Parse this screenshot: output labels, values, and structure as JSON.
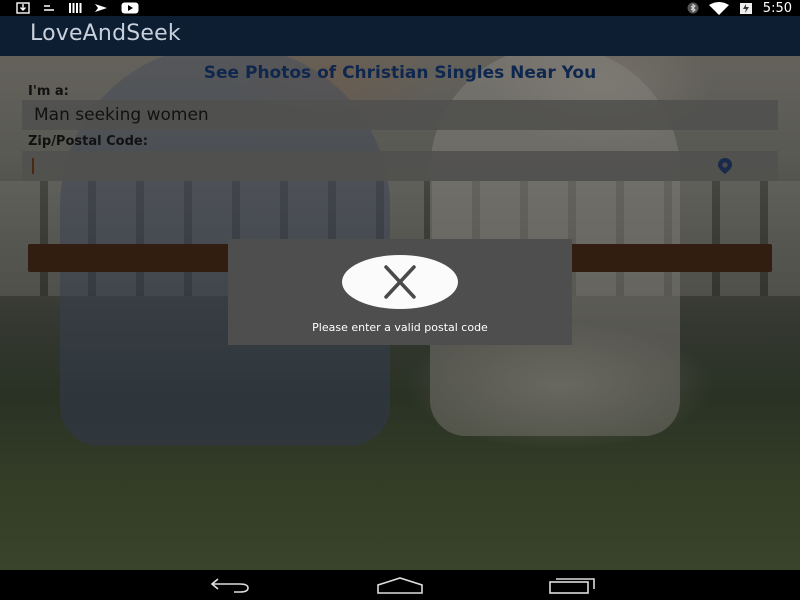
{
  "status_bar": {
    "time": "5:50",
    "left_icons": [
      "download-icon",
      "sim-icon",
      "signal-bars-icon",
      "plane-icon",
      "youtube-icon"
    ],
    "right_icons": [
      "bluetooth-icon",
      "wifi-icon",
      "battery-icon"
    ]
  },
  "app_bar": {
    "title": "LoveAndSeek"
  },
  "form": {
    "heading": "See Photos of Christian Singles Near You",
    "gender_label": "I'm a:",
    "gender_value": "Man seeking women",
    "zip_label": "Zip/Postal Code:",
    "zip_value": "",
    "location_icon": "location-pin-icon"
  },
  "dialog": {
    "icon": "error-x-icon",
    "message": "Please enter a valid postal code"
  },
  "colors": {
    "heading": "#0e3a80",
    "app_bar": "#0d1e33",
    "button": "#4e2812",
    "dialog": "#4e4e4e"
  },
  "nav_bar": {
    "icons": [
      "back-icon",
      "home-icon",
      "recents-icon"
    ]
  }
}
